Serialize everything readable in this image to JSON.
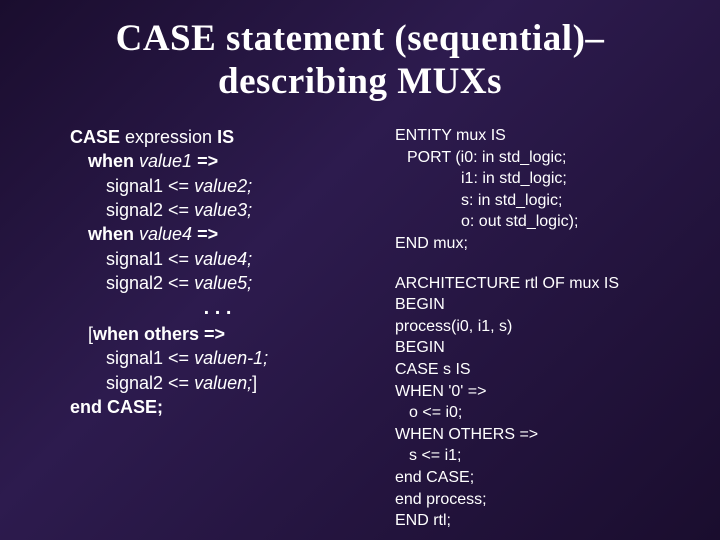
{
  "title": "CASE statement (sequential)– describing MUXs",
  "left": {
    "l1a": "CASE ",
    "l1b": "expression ",
    "l1c": "IS",
    "l2a": "when ",
    "l2b": "value1 ",
    "l2c": "=>",
    "l3a": "signal1 <= ",
    "l3b": "value2;",
    "l4a": "signal2 <= ",
    "l4b": "value3;",
    "l5a": "when ",
    "l5b": "value4 ",
    "l5c": "=>",
    "l6a": "signal1 <= ",
    "l6b": "value4;",
    "l7a": "signal2 <= ",
    "l7b": "value5;",
    "dots": ". . .",
    "l8a": "[",
    "l8b": "when others =>",
    "l9a": "signal1 <= ",
    "l9b": "valuen-1;",
    "l10a": "signal2 <= ",
    "l10b": "valuen;",
    "l10c": "]",
    "l11": "end CASE;"
  },
  "right": {
    "r1": "ENTITY mux IS",
    "r2": "PORT (i0: in std_logic;",
    "r3": "i1: in std_logic;",
    "r4": "s: in std_logic;",
    "r5": "o: out std_logic);",
    "r6": "END mux;",
    "r7": "ARCHITECTURE rtl OF mux IS",
    "r8": "BEGIN",
    "r9": "process(i0, i1, s)",
    "r10": "BEGIN",
    "r11": "CASE s IS",
    "r12": "WHEN '0' =>",
    "r13": "o <= i0;",
    "r14": "WHEN OTHERS =>",
    "r15": "s <= i1;",
    "r16": "end CASE;",
    "r17": "end process;",
    "r18": "END rtl;"
  }
}
